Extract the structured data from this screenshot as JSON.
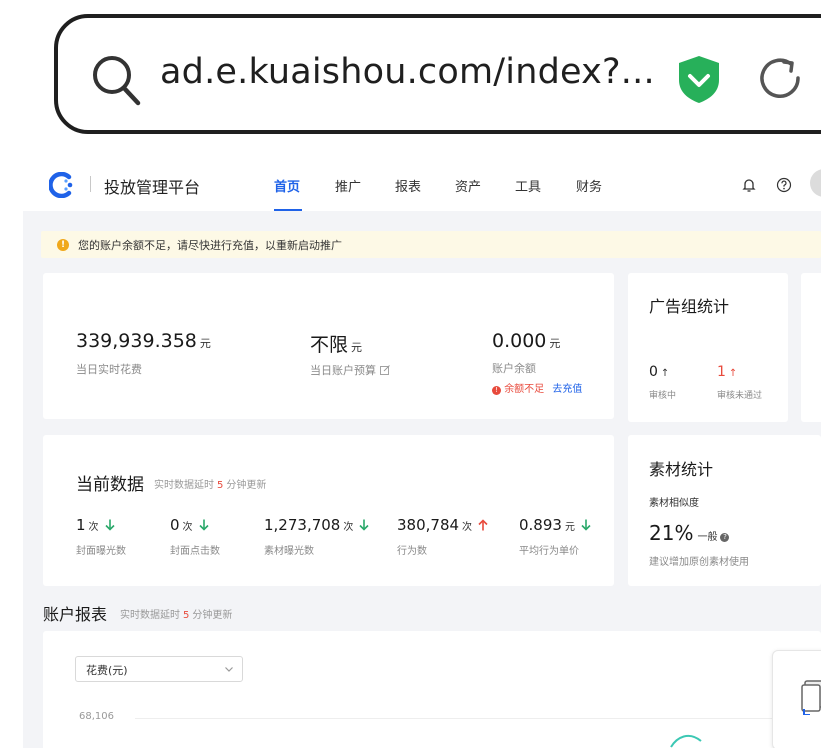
{
  "browser": {
    "url": "ad.e.kuaishou.com/index?..."
  },
  "nav": {
    "brand": "投放管理平台",
    "items": [
      "首页",
      "推广",
      "报表",
      "资产",
      "工具",
      "财务"
    ],
    "active_index": 0
  },
  "notice": {
    "text": "您的账户余额不足，请尽快进行充值，以重新启动推广"
  },
  "summary": {
    "spend_value": "339,939.358",
    "spend_unit": "元",
    "spend_label": "当日实时花费",
    "budget_value": "不限",
    "budget_unit": "元",
    "budget_label": "当日账户预算",
    "balance_value": "0.000",
    "balance_unit": "元",
    "balance_label": "账户余额",
    "balance_warning": "余额不足",
    "recharge_link": "去充值"
  },
  "adgroup_stats": {
    "title": "广告组统计",
    "reviewing_value": "0",
    "reviewing_label": "审核中",
    "rejected_value": "1",
    "rejected_label": "审核未通过"
  },
  "current_data": {
    "title": "当前数据",
    "note_prefix": "实时数据延时",
    "note_minutes": "5",
    "note_suffix": "分钟更新",
    "metrics": [
      {
        "value": "1",
        "unit": "次",
        "label": "封面曝光数",
        "trend": "down"
      },
      {
        "value": "0",
        "unit": "次",
        "label": "封面点击数",
        "trend": "down"
      },
      {
        "value": "1,273,708",
        "unit": "次",
        "label": "素材曝光数",
        "trend": "down"
      },
      {
        "value": "380,784",
        "unit": "次",
        "label": "行为数",
        "trend": "up"
      },
      {
        "value": "0.893",
        "unit": "元",
        "label": "平均行为单价",
        "trend": "down"
      }
    ]
  },
  "material_stats": {
    "title": "素材统计",
    "similarity_label": "素材相似度",
    "similarity_value": "21%",
    "similarity_level": "一般",
    "suggestion": "建议增加原创素材使用"
  },
  "account_report": {
    "title": "账户报表",
    "note_prefix": "实时数据延时",
    "note_minutes": "5",
    "note_suffix": "分钟更新",
    "metric_select": "花费(元)",
    "y_tick": "68,106"
  },
  "colors": {
    "brand_blue": "#1f62e8",
    "up_red": "#e84a3c",
    "down_green": "#2aa86a",
    "shield_green": "#27b05a",
    "warn_orange": "#f0a81b"
  }
}
